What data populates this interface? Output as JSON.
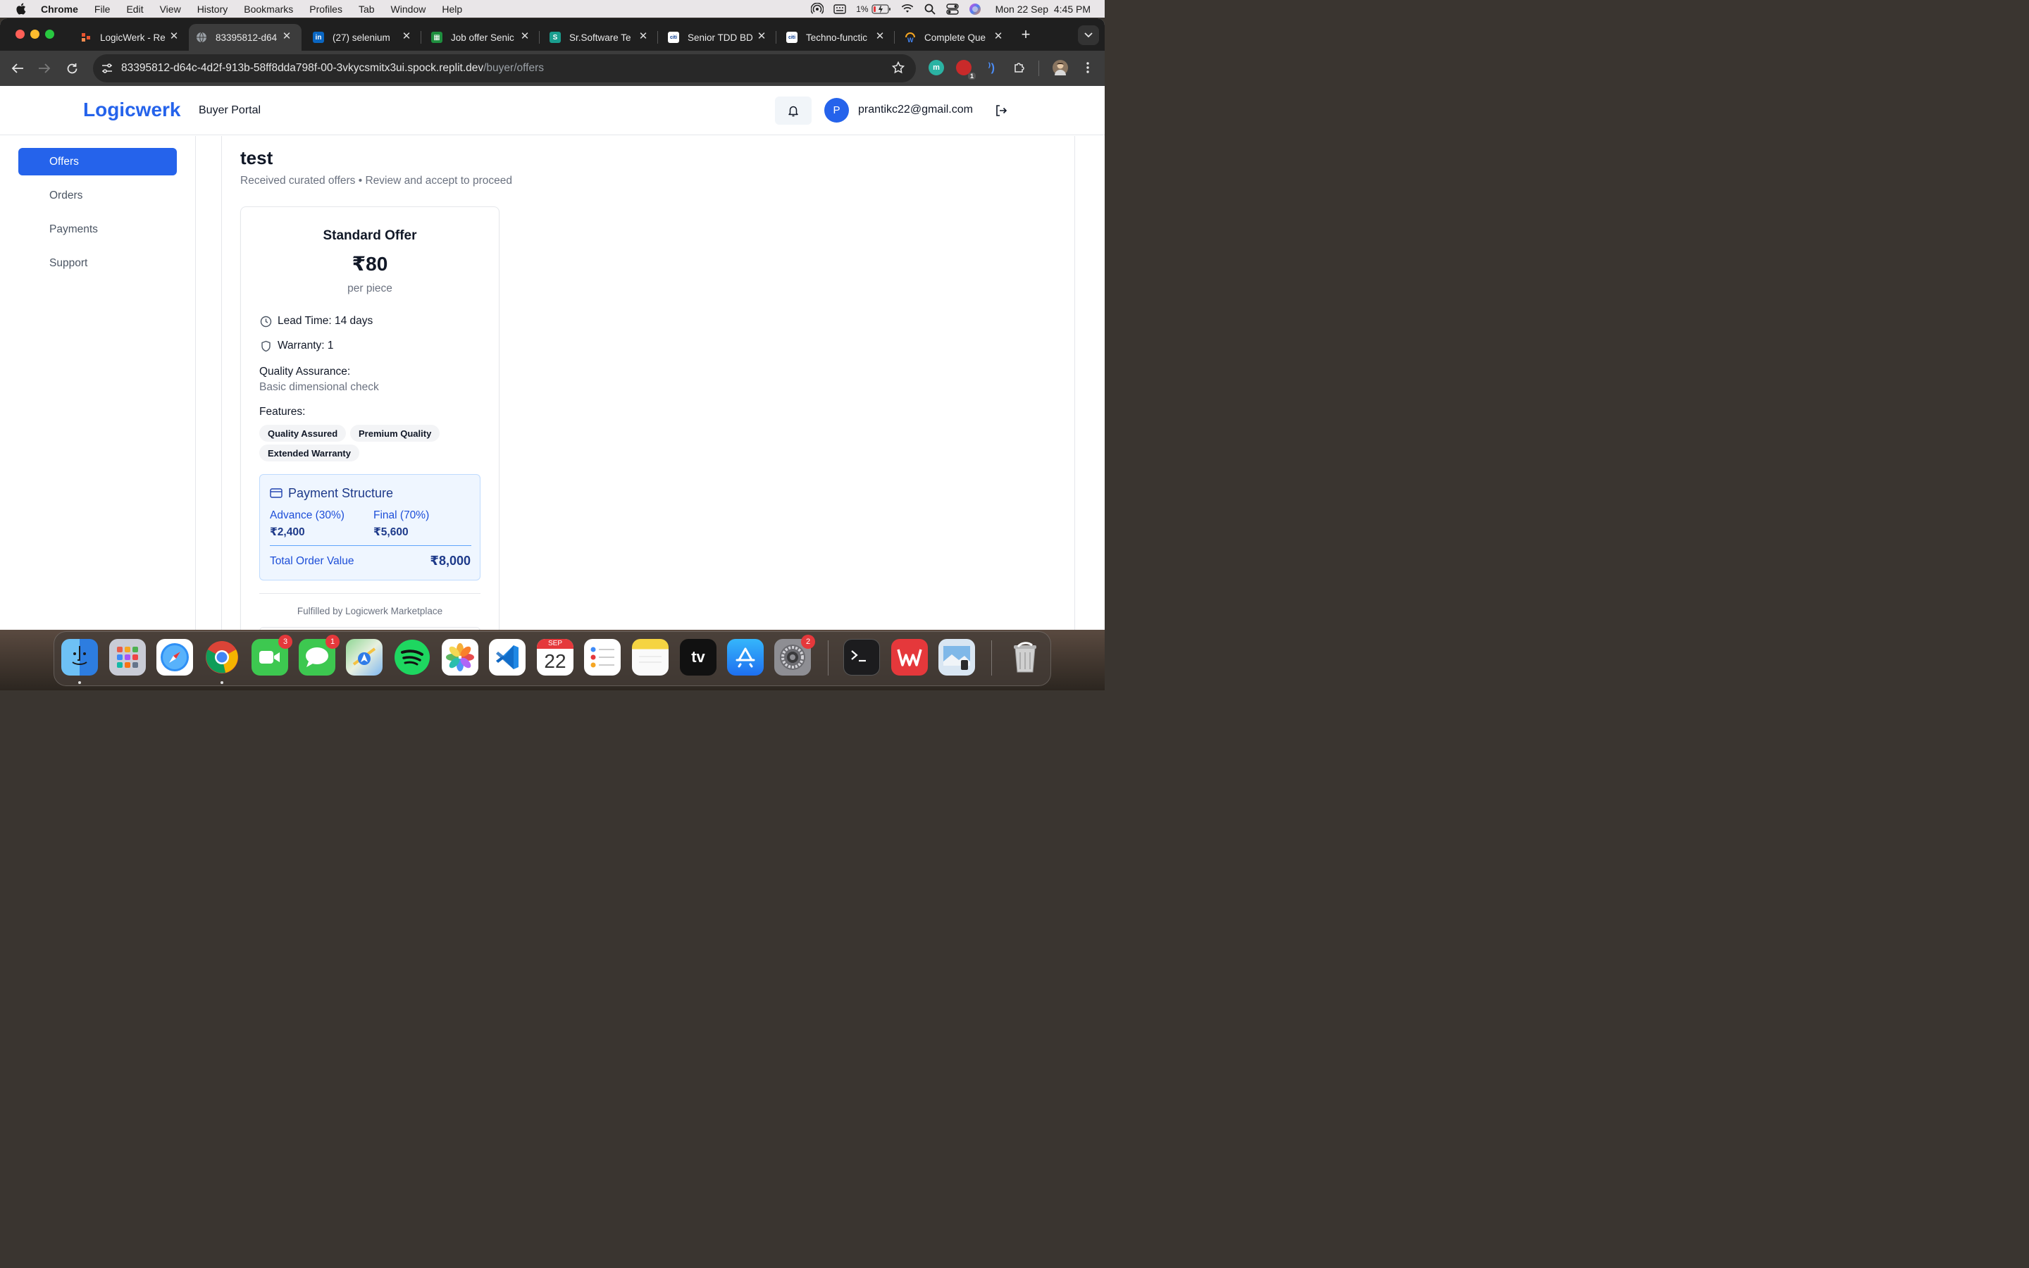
{
  "menubar": {
    "app_name": "Chrome",
    "menus": [
      "File",
      "Edit",
      "View",
      "History",
      "Bookmarks",
      "Profiles",
      "Tab",
      "Window",
      "Help"
    ],
    "battery": "1%",
    "datetime": "Mon 22 Sep  4:45 PM"
  },
  "browser": {
    "tabs": [
      {
        "title": "LogicWerk - Re",
        "favicon": "logicwerk-icon",
        "color": "#e8542f"
      },
      {
        "title": "83395812-d64",
        "favicon": "globe-icon",
        "color": "#5f6368",
        "active": true
      },
      {
        "title": "(27) selenium",
        "favicon": "linkedin-icon",
        "color": "#0a66c2"
      },
      {
        "title": "Job offer Senic",
        "favicon": "sheet-icon",
        "color": "#1e8e3e"
      },
      {
        "title": "Sr.Software Te",
        "favicon": "s-icon",
        "color": "#1a9e8f"
      },
      {
        "title": "Senior TDD BD",
        "favicon": "citi-icon",
        "color": "#ffffff"
      },
      {
        "title": "Techno-functic",
        "favicon": "citi-icon",
        "color": "#ffffff"
      },
      {
        "title": "Complete Que",
        "favicon": "w-icon",
        "color": "#f5a623"
      }
    ],
    "url_host": "83395812-d64c-4d2f-913b-58ff8dda798f-00-3vkycsmitx3ui.spock.replit.dev",
    "url_path": "/buyer/offers",
    "extension_badge": "1"
  },
  "app": {
    "logo": "Logicwerk",
    "portal_name": "Buyer Portal",
    "user_initial": "P",
    "user_email": "prantikc22@gmail.com",
    "accent": "#2563eb",
    "sidebar": [
      {
        "label": "Offers",
        "active": true
      },
      {
        "label": "Orders"
      },
      {
        "label": "Payments"
      },
      {
        "label": "Support"
      }
    ],
    "page": {
      "title": "test",
      "subtitle": "Received curated offers • Review and accept to proceed"
    },
    "offer": {
      "name": "Standard Offer",
      "price": "₹80",
      "unit": "per piece",
      "lead_time": "Lead Time: 14 days",
      "warranty": "Warranty: 1",
      "qa_label": "Quality Assurance:",
      "qa_value": "Basic dimensional check",
      "features_label": "Features:",
      "features": [
        "Quality Assured",
        "Premium Quality",
        "Extended Warranty"
      ],
      "payment": {
        "title": "Payment Structure",
        "advance_label": "Advance (30%)",
        "advance_value": "₹2,400",
        "final_label": "Final (70%)",
        "final_value": "₹5,600",
        "total_label": "Total Order Value",
        "total_value": "₹8,000"
      },
      "fulfilled_by": "Fulfilled by Logicwerk Marketplace"
    }
  },
  "dock": {
    "apps": [
      {
        "name": "Finder",
        "icon": "finder-icon"
      },
      {
        "name": "Launchpad",
        "icon": "launchpad-icon"
      },
      {
        "name": "Safari",
        "icon": "safari-icon"
      },
      {
        "name": "Chrome",
        "icon": "chrome-icon"
      },
      {
        "name": "FaceTime",
        "icon": "facetime-icon",
        "badge": "3"
      },
      {
        "name": "Messages",
        "icon": "messages-icon",
        "badge": "1"
      },
      {
        "name": "Maps",
        "icon": "maps-icon"
      },
      {
        "name": "Spotify",
        "icon": "spotify-icon"
      },
      {
        "name": "Photos",
        "icon": "photos-icon"
      },
      {
        "name": "VS Code",
        "icon": "vscode-icon"
      },
      {
        "name": "Calendar",
        "icon": "calendar-icon",
        "month": "SEP",
        "day": "22"
      },
      {
        "name": "Reminders",
        "icon": "reminders-icon"
      },
      {
        "name": "Notes",
        "icon": "notes-icon"
      },
      {
        "name": "TV",
        "icon": "tv-icon",
        "label": "tv"
      },
      {
        "name": "App Store",
        "icon": "appstore-icon"
      },
      {
        "name": "System Settings",
        "icon": "settings-icon",
        "badge": "2"
      },
      {
        "name": "Terminal",
        "icon": "terminal-icon"
      },
      {
        "name": "WPS Office",
        "icon": "wps-icon"
      },
      {
        "name": "Preview",
        "icon": "preview-icon"
      },
      {
        "name": "Trash",
        "icon": "trash-icon"
      }
    ]
  }
}
